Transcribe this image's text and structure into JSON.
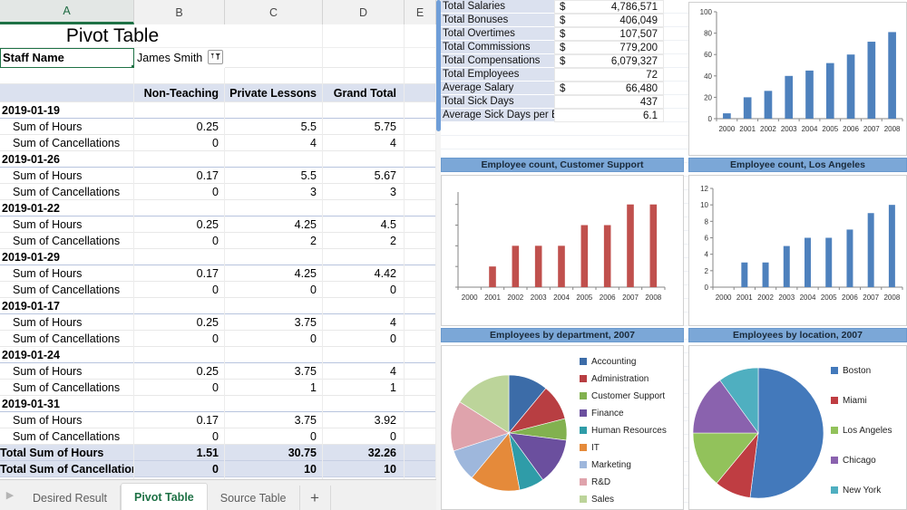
{
  "spreadsheet": {
    "columns": [
      "A",
      "B",
      "C",
      "D",
      "E"
    ],
    "selected_column": "A",
    "title": "Pivot Table",
    "filter": {
      "label": "Staff Name",
      "value": "James Smith",
      "button_icon": "filter-dropdown-icon"
    },
    "headers": {
      "col_a": "",
      "non_teaching": "Non-Teaching",
      "private_lessons": "Private Lessons",
      "grand_total": "Grand Total"
    },
    "groups": [
      {
        "date": "2019-01-19",
        "rows": [
          {
            "label": "Sum of Hours",
            "non_teaching": "0.25",
            "private_lessons": "5.5",
            "grand_total": "5.75"
          },
          {
            "label": "Sum of Cancellations",
            "non_teaching": "0",
            "private_lessons": "4",
            "grand_total": "4"
          }
        ]
      },
      {
        "date": "2019-01-26",
        "rows": [
          {
            "label": "Sum of Hours",
            "non_teaching": "0.17",
            "private_lessons": "5.5",
            "grand_total": "5.67"
          },
          {
            "label": "Sum of Cancellations",
            "non_teaching": "0",
            "private_lessons": "3",
            "grand_total": "3"
          }
        ]
      },
      {
        "date": "2019-01-22",
        "rows": [
          {
            "label": "Sum of Hours",
            "non_teaching": "0.25",
            "private_lessons": "4.25",
            "grand_total": "4.5"
          },
          {
            "label": "Sum of Cancellations",
            "non_teaching": "0",
            "private_lessons": "2",
            "grand_total": "2"
          }
        ]
      },
      {
        "date": "2019-01-29",
        "rows": [
          {
            "label": "Sum of Hours",
            "non_teaching": "0.17",
            "private_lessons": "4.25",
            "grand_total": "4.42"
          },
          {
            "label": "Sum of Cancellations",
            "non_teaching": "0",
            "private_lessons": "0",
            "grand_total": "0"
          }
        ]
      },
      {
        "date": "2019-01-17",
        "rows": [
          {
            "label": "Sum of Hours",
            "non_teaching": "0.25",
            "private_lessons": "3.75",
            "grand_total": "4"
          },
          {
            "label": "Sum of Cancellations",
            "non_teaching": "0",
            "private_lessons": "0",
            "grand_total": "0"
          }
        ]
      },
      {
        "date": "2019-01-24",
        "rows": [
          {
            "label": "Sum of Hours",
            "non_teaching": "0.25",
            "private_lessons": "3.75",
            "grand_total": "4"
          },
          {
            "label": "Sum of Cancellations",
            "non_teaching": "0",
            "private_lessons": "1",
            "grand_total": "1"
          }
        ]
      },
      {
        "date": "2019-01-31",
        "rows": [
          {
            "label": "Sum of Hours",
            "non_teaching": "0.17",
            "private_lessons": "3.75",
            "grand_total": "3.92"
          },
          {
            "label": "Sum of Cancellations",
            "non_teaching": "0",
            "private_lessons": "0",
            "grand_total": "0"
          }
        ]
      }
    ],
    "grand_totals": [
      {
        "label": "Total Sum of Hours",
        "non_teaching": "1.51",
        "private_lessons": "30.75",
        "grand_total": "32.26"
      },
      {
        "label": "Total Sum of Cancellations",
        "non_teaching": "0",
        "private_lessons": "10",
        "grand_total": "10"
      }
    ],
    "tabs": [
      {
        "label": "Desired Result",
        "active": false
      },
      {
        "label": "Pivot Table",
        "active": true
      },
      {
        "label": "Source Table",
        "active": false
      }
    ],
    "add_tab_label": "+",
    "scroll_arrow": "▶"
  },
  "right_panel": {
    "summary_rows": [
      {
        "label": "Total Salaries",
        "currency": "$",
        "value": "4,786,571"
      },
      {
        "label": "Total Bonuses",
        "currency": "$",
        "value": "406,049"
      },
      {
        "label": "Total Overtimes",
        "currency": "$",
        "value": "107,507"
      },
      {
        "label": "Total Commissions",
        "currency": "$",
        "value": "779,200"
      },
      {
        "label": "Total Compensations",
        "currency": "$",
        "value": "6,079,327"
      },
      {
        "label": "Total Employees",
        "currency": "",
        "value": "72"
      },
      {
        "label": "Average Salary",
        "currency": "$",
        "value": "66,480"
      },
      {
        "label": "Total Sick Days",
        "currency": "",
        "value": "437"
      },
      {
        "label": "Average Sick Days per Emp.",
        "currency": "",
        "value": "6.1"
      }
    ]
  },
  "chart_data": [
    {
      "id": "employee-count-total",
      "type": "bar",
      "title": "",
      "categories": [
        "2000",
        "2001",
        "2002",
        "2003",
        "2004",
        "2005",
        "2006",
        "2007",
        "2008"
      ],
      "values": [
        5,
        20,
        26,
        40,
        45,
        52,
        60,
        72,
        81
      ],
      "ytick_labels": [
        "0",
        "20",
        "40",
        "60",
        "80",
        "100"
      ],
      "yticks": [
        0,
        20,
        40,
        60,
        80,
        100
      ],
      "ylim": [
        0,
        100
      ],
      "xlabel": "",
      "ylabel": "",
      "bar_color": "#4e81bd",
      "grid": false,
      "legend": "none"
    },
    {
      "id": "employee-count-customer-support",
      "type": "bar",
      "title": "Employee count, Customer Support",
      "categories": [
        "2000",
        "2001",
        "2002",
        "2003",
        "2004",
        "2005",
        "2006",
        "2007",
        "2008"
      ],
      "values": [
        0,
        1,
        2,
        2,
        2,
        3,
        3,
        4,
        4
      ],
      "ytick_labels": [
        "",
        "",
        "",
        "",
        ""
      ],
      "yticks": [
        0,
        1,
        2,
        3,
        4
      ],
      "ylim": [
        0,
        4.6
      ],
      "xlabel": "",
      "ylabel": "",
      "bar_color": "#c0504d",
      "grid": false,
      "legend": "none"
    },
    {
      "id": "employee-count-los-angeles",
      "type": "bar",
      "title": "Employee count, Los Angeles",
      "categories": [
        "2000",
        "2001",
        "2002",
        "2003",
        "2004",
        "2005",
        "2006",
        "2007",
        "2008"
      ],
      "values": [
        0,
        3,
        3,
        5,
        6,
        6,
        7,
        9,
        10
      ],
      "ytick_labels": [
        "0",
        "2",
        "4",
        "6",
        "8",
        "10",
        "12"
      ],
      "yticks": [
        0,
        2,
        4,
        6,
        8,
        10,
        12
      ],
      "ylim": [
        0,
        12
      ],
      "xlabel": "",
      "ylabel": "",
      "bar_color": "#4e81bd",
      "grid": false,
      "legend": "none"
    },
    {
      "id": "employees-by-department-2007",
      "type": "pie",
      "title": "Employees by department, 2007",
      "legend_position": "right",
      "labels": [
        "Accounting",
        "Administration",
        "Customer Support",
        "Finance",
        "Human Resources",
        "IT",
        "Marketing",
        "R&D",
        "Sales"
      ],
      "values": [
        11,
        10,
        6,
        13,
        7,
        14,
        9,
        14,
        16
      ],
      "colors": [
        "#3c6ca8",
        "#b83e42",
        "#82b14f",
        "#6b4f9e",
        "#2f9ca8",
        "#e58a3a",
        "#9eb7dc",
        "#dfa3ac",
        "#bcd49a"
      ]
    },
    {
      "id": "employees-by-location-2007",
      "type": "pie",
      "title": "Employees by location, 2007",
      "legend_position": "right",
      "labels": [
        "Boston",
        "Miami",
        "Los Angeles",
        "Chicago",
        "New York"
      ],
      "values": [
        52,
        9,
        14,
        15,
        10
      ],
      "colors": [
        "#4379bb",
        "#bf3d42",
        "#92c25b",
        "#8a62ae",
        "#4fafc0"
      ]
    }
  ]
}
